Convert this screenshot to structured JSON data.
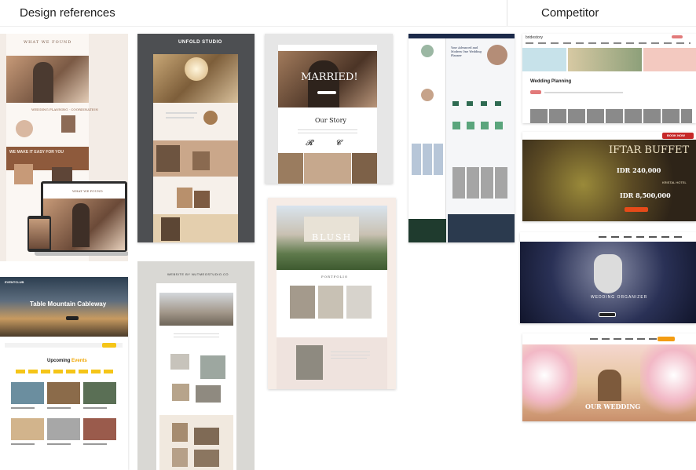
{
  "headings": {
    "design_references": "Design references",
    "competitor": "Competitor"
  },
  "cards": {
    "wedding_1": {
      "logo": "WHAT WE FOUND",
      "section_title": "WEDDING PLANNING · COORDINATION",
      "band_title": "WE MAKE IT EASY FOR YOU",
      "laptop_logo": "WHAT WE FOUND"
    },
    "unfold": {
      "logo": "UNFOLD STUDIO"
    },
    "married": {
      "hero": "MARRIED!",
      "story": "Our Story"
    },
    "planner": {
      "hero": "Your Advanced and Modern One Wedding Planner"
    },
    "event": {
      "logo": "EVENTCLUB",
      "hero": "Table Mountain Cableway",
      "section": "Upcoming",
      "section_accent": "Events"
    },
    "nutmeg": {
      "label": "WEBSITE BY NUTMEGSTUDIO.CO"
    },
    "blush": {
      "logo": "BLUSH",
      "section": "PORTFOLIO"
    },
    "competitor_1": {
      "logo": "bridestory",
      "heading": "Wedding Planning"
    },
    "competitor_2": {
      "title": "IFTAR BUFFET",
      "price1": "IDR 240,000",
      "price2": "IDR 8,500,000",
      "venue": "KRISTAL HOTEL",
      "cta": "BOOK NOW"
    },
    "competitor_3": {
      "title": "WEDDING ORGANIZER"
    },
    "competitor_4": {
      "title": "OUR WEDDING"
    }
  }
}
